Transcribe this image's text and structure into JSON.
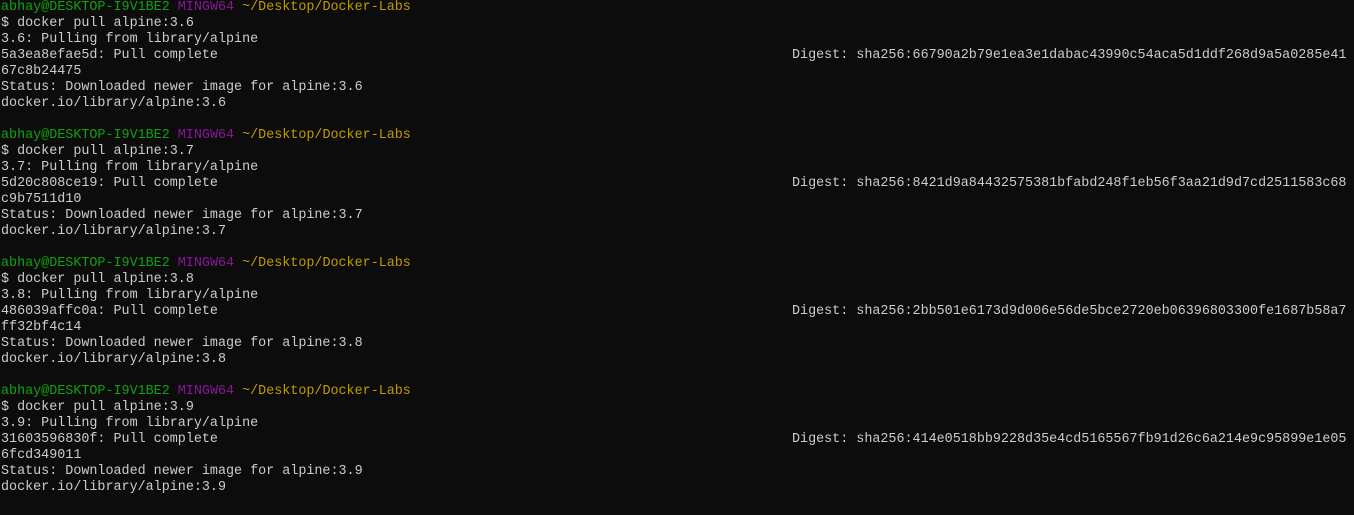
{
  "colors": {
    "background": "#0c0c0c",
    "text": "#cccccc",
    "user_host": "#13a10e",
    "shell": "#881798",
    "path": "#c19c00"
  },
  "blocks": [
    {
      "prompt": {
        "user_host": "abhay@DESKTOP-I9V1BE2",
        "shell": "MINGW64",
        "path": "~/Desktop/Docker-Labs"
      },
      "command": "$ docker pull alpine:3.6",
      "pulling": "3.6: Pulling from library/alpine",
      "layer": "5a3ea8efae5d: Pull complete",
      "digest": "Digest: sha256:66790a2b79e1ea3e1dabac43990c54aca5d1ddf268d9a5a0285e41",
      "digest_wrap": "67c8b24475",
      "status": "Status: Downloaded newer image for alpine:3.6",
      "ref": "docker.io/library/alpine:3.6"
    },
    {
      "prompt": {
        "user_host": "abhay@DESKTOP-I9V1BE2",
        "shell": "MINGW64",
        "path": "~/Desktop/Docker-Labs"
      },
      "command": "$ docker pull alpine:3.7",
      "pulling": "3.7: Pulling from library/alpine",
      "layer": "5d20c808ce19: Pull complete",
      "digest": "Digest: sha256:8421d9a84432575381bfabd248f1eb56f3aa21d9d7cd2511583c68",
      "digest_wrap": "c9b7511d10",
      "status": "Status: Downloaded newer image for alpine:3.7",
      "ref": "docker.io/library/alpine:3.7"
    },
    {
      "prompt": {
        "user_host": "abhay@DESKTOP-I9V1BE2",
        "shell": "MINGW64",
        "path": "~/Desktop/Docker-Labs"
      },
      "command": "$ docker pull alpine:3.8",
      "pulling": "3.8: Pulling from library/alpine",
      "layer": "486039affc0a: Pull complete",
      "digest": "Digest: sha256:2bb501e6173d9d006e56de5bce2720eb06396803300fe1687b58a7",
      "digest_wrap": "ff32bf4c14",
      "status": "Status: Downloaded newer image for alpine:3.8",
      "ref": "docker.io/library/alpine:3.8"
    },
    {
      "prompt": {
        "user_host": "abhay@DESKTOP-I9V1BE2",
        "shell": "MINGW64",
        "path": "~/Desktop/Docker-Labs"
      },
      "command": "$ docker pull alpine:3.9",
      "pulling": "3.9: Pulling from library/alpine",
      "layer": "31603596830f: Pull complete",
      "digest": "Digest: sha256:414e0518bb9228d35e4cd5165567fb91d26c6a214e9c95899e1e05",
      "digest_wrap": "6fcd349011",
      "status": "Status: Downloaded newer image for alpine:3.9",
      "ref": "docker.io/library/alpine:3.9"
    }
  ]
}
